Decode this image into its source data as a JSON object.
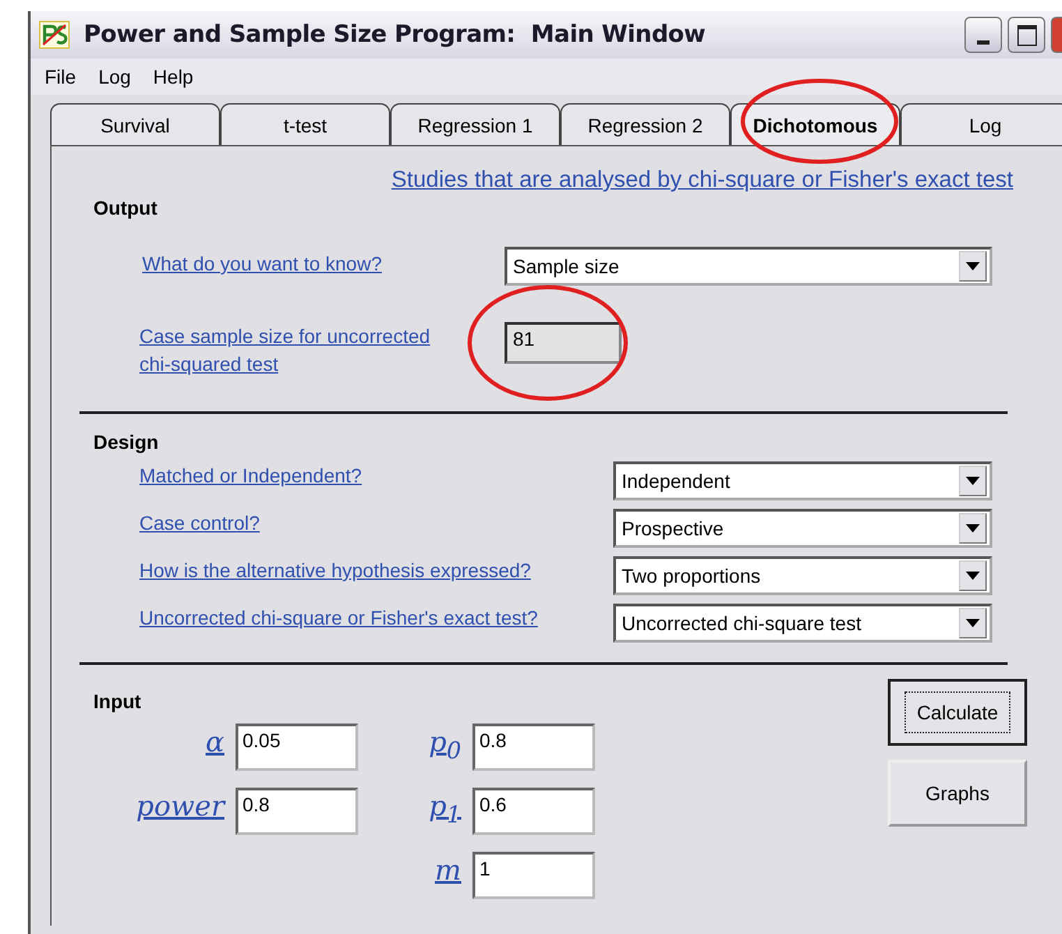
{
  "window": {
    "title": "Power and Sample Size Program:  Main Window"
  },
  "menu": [
    "File",
    "Log",
    "Help"
  ],
  "tabs": [
    {
      "label": "Survival",
      "selected": false,
      "circled": false
    },
    {
      "label": "t-test",
      "selected": false,
      "circled": false
    },
    {
      "label": "Regression 1",
      "selected": false,
      "circled": false
    },
    {
      "label": "Regression 2",
      "selected": false,
      "circled": false
    },
    {
      "label": "Dichotomous",
      "selected": true,
      "circled": true
    },
    {
      "label": "Log",
      "selected": false,
      "circled": false
    }
  ],
  "header_link": "Studies that are analysed by chi-square or Fisher's exact test",
  "output": {
    "heading": "Output",
    "question": {
      "label": "What do you want to know?",
      "value": "Sample size"
    },
    "result": {
      "label": "Case sample size for uncorrected chi-squared test",
      "value": "81",
      "circled": true
    }
  },
  "design": {
    "heading": "Design",
    "rows": [
      {
        "label": "Matched or Independent?",
        "value": "Independent"
      },
      {
        "label": "Case control?",
        "value": "Prospective"
      },
      {
        "label": "How is the alternative hypothesis expressed?",
        "value": "Two proportions"
      },
      {
        "label": "Uncorrected chi-square or Fisher's exact test?",
        "value": "Uncorrected chi-square test"
      }
    ]
  },
  "input": {
    "heading": "Input",
    "columns": [
      [
        {
          "label": "α",
          "value": "0.05"
        },
        {
          "label": "power",
          "value": "0.8"
        }
      ],
      [
        {
          "label": "p$_{0}$",
          "value": "0.8"
        },
        {
          "label": "p$_{1}$",
          "value": "0.6"
        },
        {
          "label": "m",
          "value": "1"
        }
      ]
    ]
  },
  "buttons": [
    {
      "label": "Calculate",
      "focused": true
    },
    {
      "label": "Graphs",
      "focused": false
    }
  ]
}
